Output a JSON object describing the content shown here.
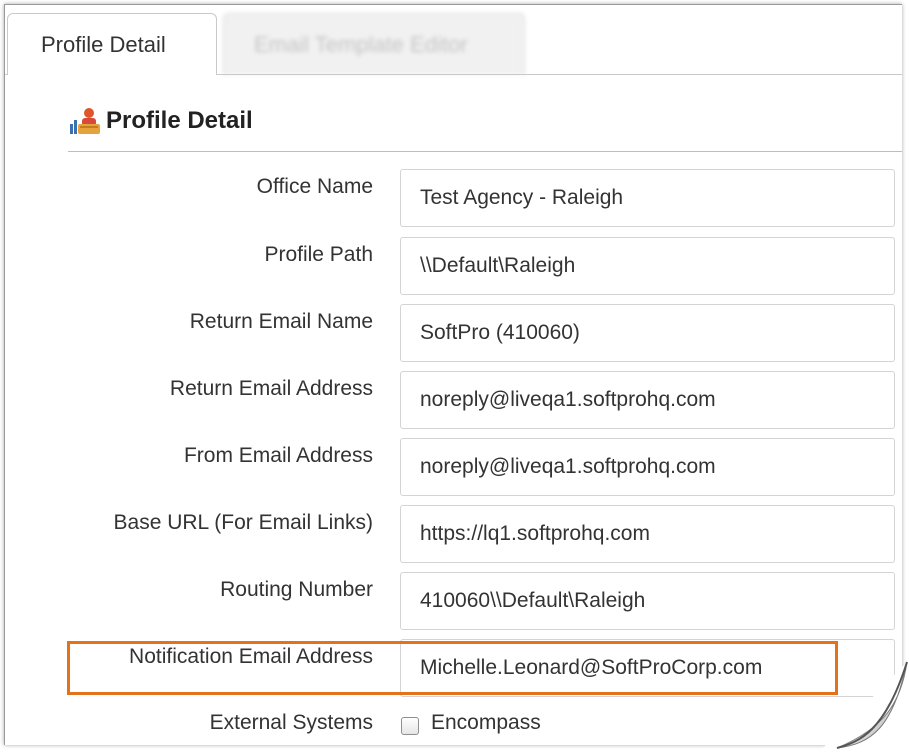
{
  "tabs": [
    {
      "label": "Profile Detail",
      "active": true
    },
    {
      "label": "Email Template Editor",
      "active": false
    }
  ],
  "section": {
    "title": "Profile Detail",
    "icon": "profile-icon"
  },
  "fields": [
    {
      "label": "Office Name",
      "value": "Test Agency - Raleigh"
    },
    {
      "label": "Profile Path",
      "value": "\\\\Default\\Raleigh"
    },
    {
      "label": "Return Email Name",
      "value": "SoftPro (410060)"
    },
    {
      "label": "Return Email Address",
      "value": "noreply@liveqa1.softprohq.com"
    },
    {
      "label": "From Email Address",
      "value": "noreply@liveqa1.softprohq.com"
    },
    {
      "label": "Base URL (For Email Links)",
      "value": "https://lq1.softprohq.com"
    },
    {
      "label": "Routing Number",
      "value": "410060\\\\Default\\Raleigh"
    },
    {
      "label": "Notification Email Address",
      "value": "Michelle.Leonard@SoftProCorp.com"
    }
  ],
  "external_systems": {
    "label": "External Systems",
    "option": "Encompass",
    "checked": false
  },
  "colors": {
    "highlight": "#e2731c",
    "border": "#d4d4d4"
  }
}
